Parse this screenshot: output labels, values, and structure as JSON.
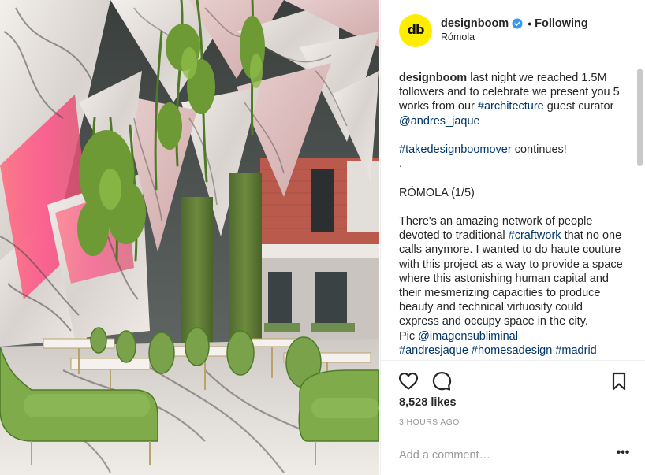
{
  "photo": {
    "alt_icon": "restaurant-interior-photo"
  },
  "header": {
    "username": "designboom",
    "avatar_text": "db",
    "separator": "•",
    "follow_status": "Following",
    "location": "Rómola"
  },
  "caption": {
    "username": "designboom",
    "p1": {
      "t1": "last night we reached 1.5M followers and to celebrate we present you 5 works from our ",
      "tag1": "#architecture",
      "t2": " guest curator ",
      "tag2": "@andres_jaque"
    },
    "p2": {
      "tag": "#takedesignboomover",
      "t": " continues!"
    },
    "p3": ".",
    "p4": "RÓMOLA (1/5)",
    "p5": {
      "t1": "There's an amazing network of people devoted to traditional ",
      "tag": "#craftwork",
      "t2": " that no one calls anymore. I wanted to do haute couture with this project as a way to provide a space where this astonishing human capital and their mesmerizing capacities to produce beauty and technical virtuosity could express and occupy space in the city."
    },
    "p6": {
      "t": "Pic ",
      "tag": "@imagensubliminal"
    },
    "p7": {
      "tag1": "#andresjaque",
      "t1": " ",
      "tag2": "#homesadesign",
      "t2": " ",
      "tag3": "#madrid"
    }
  },
  "actions": {
    "icons": [
      "heart-icon",
      "comment-icon",
      "bookmark-icon"
    ]
  },
  "likes_text": "8,528 likes",
  "time_ago": "3 HOURS AGO",
  "comment": {
    "placeholder": "Add a comment…",
    "more_label": "•••"
  },
  "colors": {
    "link": "#003569",
    "verified": "#3897f0",
    "avatar_bg": "#ffed00",
    "muted": "#999999"
  }
}
